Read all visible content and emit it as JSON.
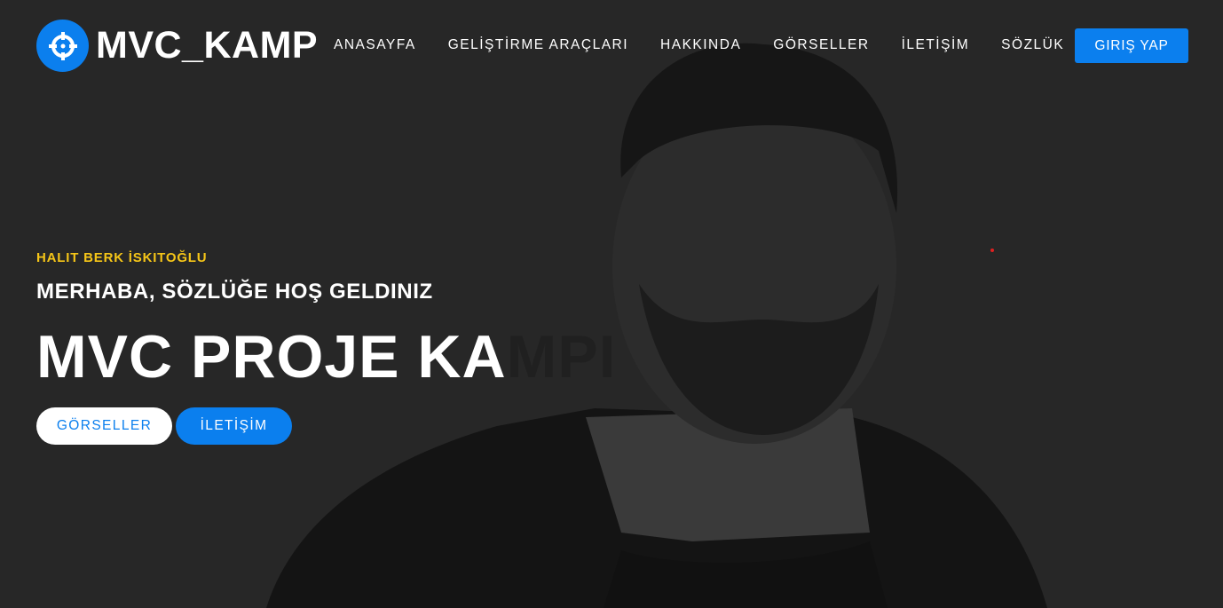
{
  "brand": {
    "name": "MVC_KAMP",
    "icon": "crosshairs-icon",
    "accent": "#0b7fee"
  },
  "nav": {
    "items": [
      "ANASAYFA",
      "GELİŞTİRME ARAÇLARI",
      "HAKKINDA",
      "GÖRSELLER",
      "İLETİŞİM",
      "SÖZLÜK"
    ],
    "login": "GIRIŞ YAP"
  },
  "hero": {
    "author": "HALIT BERK İSKITOĞLU",
    "subtitle": "MERHABA, SÖZLÜĞE HOŞ GELDINIZ",
    "title_typed": "MVC PROJE KA",
    "title_rest": "MPI",
    "buttons": [
      "GÖRSELLER",
      "İLETİŞİM"
    ]
  }
}
